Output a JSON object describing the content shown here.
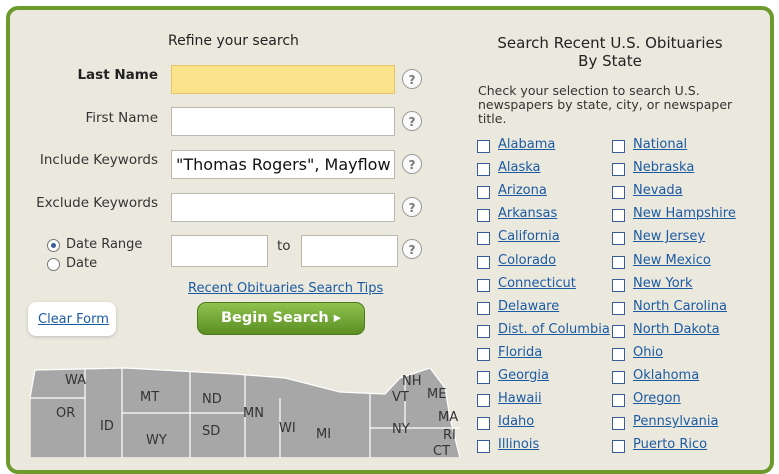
{
  "left": {
    "title": "Refine your search",
    "last_name_label": "Last Name",
    "first_name_label": "First Name",
    "include_label": "Include Keywords",
    "include_value": "\"Thomas Rogers\", Mayflow",
    "exclude_label": "Exclude Keywords",
    "date_range_label": "Date Range",
    "date_label": "Date",
    "to_label": "to",
    "help_glyph": "?",
    "tips_link": "Recent Obituaries Search Tips",
    "clear_button": "Clear Form",
    "begin_button": "Begin Search ▸",
    "map_states": [
      "WA",
      "MT",
      "ND",
      "MN",
      "OR",
      "ID",
      "SD",
      "WY",
      "WI",
      "MI",
      "NH",
      "VT",
      "ME",
      "MA",
      "NY",
      "RI",
      "CT"
    ]
  },
  "right": {
    "title_line1": "Search Recent U.S. Obituaries",
    "title_line2": "By State",
    "description": "Check your selection to search U.S. newspapers by state, city, or newspaper title.",
    "states_col1": [
      "Alabama",
      "Alaska",
      "Arizona",
      "Arkansas",
      "California",
      "Colorado",
      "Connecticut",
      "Delaware",
      "Dist. of Columbia",
      "Florida",
      "Georgia",
      "Hawaii",
      "Idaho",
      "Illinois"
    ],
    "states_col2": [
      "National",
      "Nebraska",
      "Nevada",
      "New Hampshire",
      "New Jersey",
      "New Mexico",
      "New York",
      "North Carolina",
      "North Dakota",
      "Ohio",
      "Oklahoma",
      "Oregon",
      "Pennsylvania",
      "Puerto Rico"
    ]
  },
  "colors": {
    "accent_green": "#6d9a2c",
    "link": "#1c5aa3",
    "highlight": "#fde28c"
  }
}
